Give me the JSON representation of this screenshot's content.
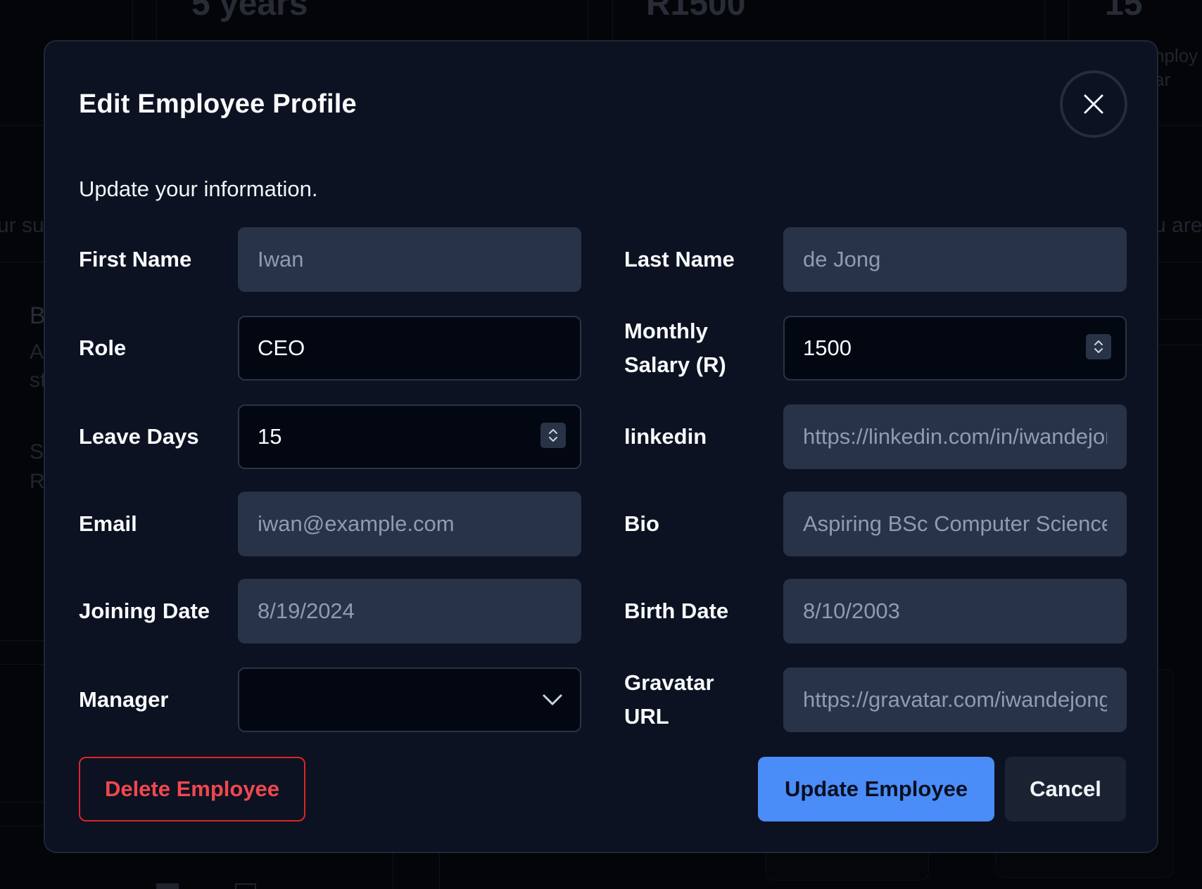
{
  "background": {
    "stat_1": "5 years",
    "stat_2": "R1500",
    "stat_3": "15",
    "stat_3_caption_1": "nploy",
    "stat_3_caption_2": "ar",
    "left_text_1": "ur su",
    "right_text_1": "u are",
    "left_letter_b": "B",
    "left_letter_a": "A",
    "left_letter_st": "st",
    "left_letter_s": "S",
    "left_letter_r": "R"
  },
  "modal": {
    "title": "Edit Employee Profile",
    "description": "Update your information.",
    "close_label": "Close"
  },
  "fields": {
    "first_name": {
      "label": "First Name",
      "value": "Iwan"
    },
    "last_name": {
      "label": "Last Name",
      "value": "de Jong"
    },
    "role": {
      "label": "Role",
      "value": "CEO"
    },
    "monthly_salary": {
      "label": "Monthly Salary (R)",
      "value": "1500"
    },
    "leave_days": {
      "label": "Leave Days",
      "value": "15"
    },
    "linkedin": {
      "label": "linkedin",
      "value": "https://linkedin.com/in/iwandejong"
    },
    "email": {
      "label": "Email",
      "value": "iwan@example.com"
    },
    "bio": {
      "label": "Bio",
      "value": "Aspiring BSc Computer Science student"
    },
    "joining_date": {
      "label": "Joining Date",
      "value": "8/19/2024"
    },
    "birth_date": {
      "label": "Birth Date",
      "value": "8/10/2003"
    },
    "manager": {
      "label": "Manager",
      "value": ""
    },
    "gravatar_url": {
      "label": "Gravatar URL",
      "value": "https://gravatar.com/iwandejong"
    }
  },
  "actions": {
    "delete_label": "Delete Employee",
    "update_label": "Update Employee",
    "cancel_label": "Cancel"
  },
  "colors": {
    "modal_bg": "#0c1221",
    "input_filled_bg": "#283347",
    "input_dark_bg": "#030712",
    "primary": "#4b8df8",
    "danger": "#dc2626"
  },
  "icons": {
    "close": "close-icon",
    "stepper": "stepper-icon",
    "chevron": "chevron-down-icon"
  }
}
